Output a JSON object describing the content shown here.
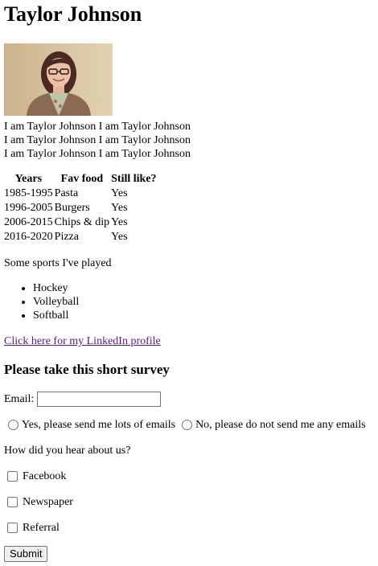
{
  "header": {
    "name": "Taylor Johnson"
  },
  "bio": {
    "lines": [
      "I am Taylor Johnson I am Taylor Johnson",
      "I am Taylor Johnson I am Taylor Johnson",
      "I am Taylor Johnson I am Taylor Johnson"
    ]
  },
  "table": {
    "headers": [
      "Years",
      "Fav food",
      "Still like?"
    ],
    "rows": [
      [
        "1985-1995",
        "Pasta",
        "Yes"
      ],
      [
        "1996-2005",
        "Burgers",
        "Yes"
      ],
      [
        "2006-2015",
        "Chips & dip",
        "Yes"
      ],
      [
        "2016-2020",
        "Pizza",
        "Yes"
      ]
    ]
  },
  "sports": {
    "intro": "Some sports I've played",
    "items": [
      "Hockey",
      "Volleyball",
      "Softball"
    ]
  },
  "link": {
    "text": "Click here for my LinkedIn profile"
  },
  "survey": {
    "title": "Please take this short survey",
    "email_label": "Email:",
    "email_value": "",
    "radio_yes": "Yes, please send me lots of emails",
    "radio_no": "No, please do not send me any emails",
    "hear_question": "How did you hear about us?",
    "checkboxes": [
      "Facebook",
      "Newspaper",
      "Referral"
    ],
    "submit_label": "Submit"
  }
}
